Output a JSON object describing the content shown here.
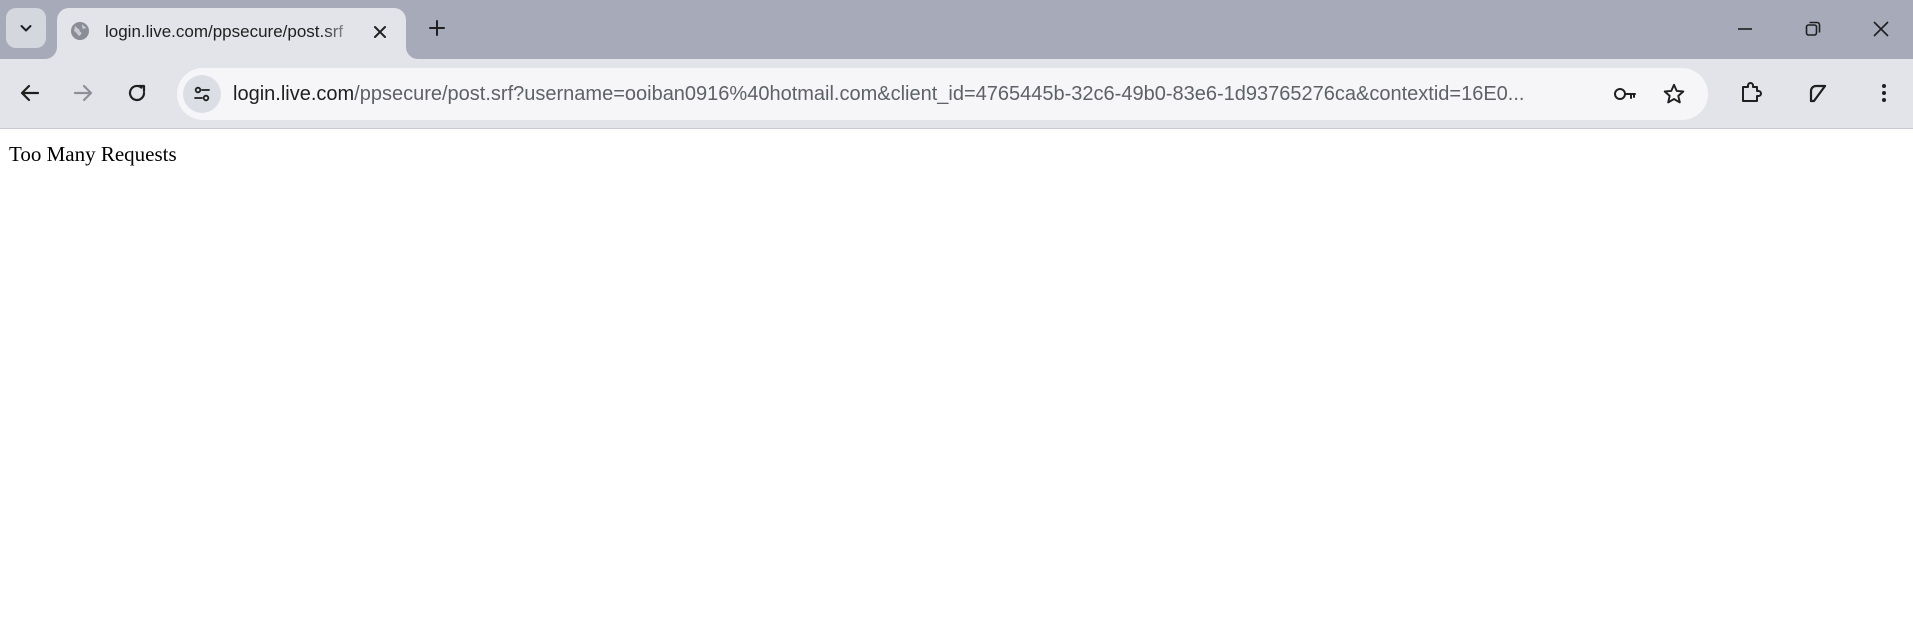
{
  "browser": {
    "tab": {
      "title": "login.live.com/ppsecure/post.srf",
      "favicon": "globe-icon",
      "close_icon": "close-icon"
    },
    "new_tab_icon": "plus-icon",
    "tab_search_icon": "chevron-down-icon",
    "window_controls": [
      "minimize-icon",
      "restore-icon",
      "close-icon"
    ],
    "nav": {
      "back_icon": "arrow-left-icon",
      "forward_icon": "arrow-right-icon",
      "reload_icon": "reload-icon"
    },
    "address_bar": {
      "site_info_icon": "tune-icon",
      "url_host": "login.live.com",
      "url_rest": "/ppsecure/post.srf?username=ooiban0916%40hotmail.com&client_id=4765445b-32c6-49b0-83e6-1d93765276ca&contextid=16E0...",
      "password_icon": "key-icon",
      "bookmark_icon": "star-icon"
    },
    "toolbar_icons": [
      "puzzle-icon",
      "profile-icon",
      "more-vert-icon"
    ],
    "colors": {
      "tabstrip": "#a7aab8",
      "active_tab": "#e3e4ea",
      "omnibox": "#f6f6f8"
    }
  },
  "page": {
    "message": "Too Many Requests"
  }
}
